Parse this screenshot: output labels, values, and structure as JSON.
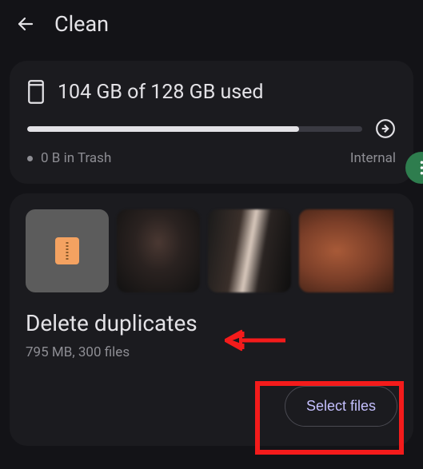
{
  "header": {
    "title": "Clean"
  },
  "storage": {
    "used_text": "104 GB of 128 GB used",
    "trash_text": "0 B in Trash",
    "location": "Internal",
    "progress_percent": 81.25
  },
  "duplicates": {
    "title": "Delete duplicates",
    "subtitle": "795 MB, 300 files",
    "select_label": "Select files",
    "thumbs": [
      "zip-file",
      "photo-1",
      "photo-2",
      "photo-3"
    ]
  }
}
